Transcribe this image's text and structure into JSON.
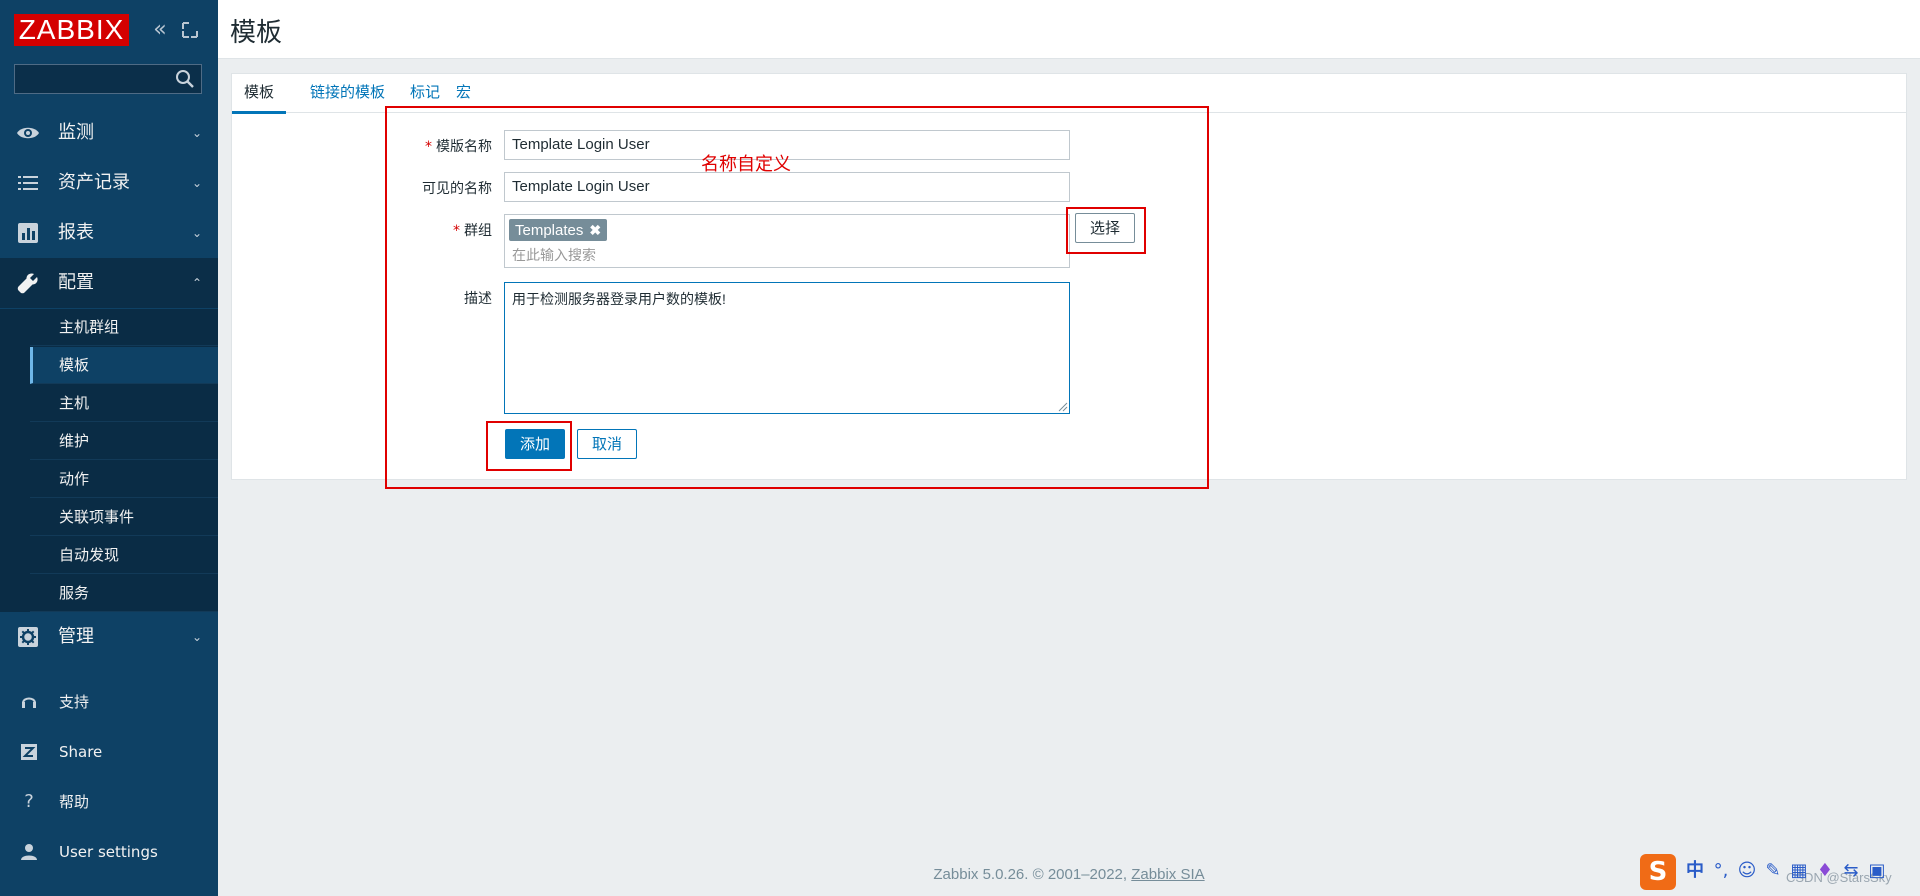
{
  "app": {
    "logo_text": "ZABBIX"
  },
  "sidebar": {
    "search": {
      "value": "",
      "placeholder": ""
    },
    "menu": [
      {
        "label": "监测",
        "icon": "eye-icon",
        "expanded": false
      },
      {
        "label": "资产记录",
        "icon": "list-icon",
        "expanded": false
      },
      {
        "label": "报表",
        "icon": "bar-chart-icon",
        "expanded": false
      },
      {
        "label": "配置",
        "icon": "wrench-icon",
        "expanded": true
      },
      {
        "label": "管理",
        "icon": "gear-icon",
        "expanded": false
      }
    ],
    "config_submenu": [
      {
        "label": "主机群组",
        "active": false
      },
      {
        "label": "模板",
        "active": true
      },
      {
        "label": "主机",
        "active": false
      },
      {
        "label": "维护",
        "active": false
      },
      {
        "label": "动作",
        "active": false
      },
      {
        "label": "关联项事件",
        "active": false
      },
      {
        "label": "自动发现",
        "active": false
      },
      {
        "label": "服务",
        "active": false
      }
    ],
    "aux": [
      {
        "label": "支持",
        "icon": "headset-icon"
      },
      {
        "label": "Share",
        "icon": "share-z-icon"
      },
      {
        "label": "帮助",
        "icon": "question-icon"
      },
      {
        "label": "User settings",
        "icon": "user-icon"
      }
    ]
  },
  "header": {
    "title": "模板"
  },
  "tabs": [
    {
      "label": "模板",
      "active": true
    },
    {
      "label": "链接的模板",
      "active": false
    },
    {
      "label": "标记",
      "active": false
    },
    {
      "label": "宏",
      "active": false
    }
  ],
  "form": {
    "required_mark": "*",
    "template_name": {
      "label": "模版名称",
      "value": "Template Login User"
    },
    "visible_name": {
      "label": "可见的名称",
      "value": "Template Login User"
    },
    "groups": {
      "label": "群组",
      "tag": "Templates",
      "placeholder": "在此输入搜索",
      "select_label": "选择"
    },
    "description": {
      "label": "描述",
      "value": "用于检测服务器登录用户数的模板!"
    },
    "add_label": "添加",
    "cancel_label": "取消"
  },
  "annotation": {
    "text": "名称自定义",
    "color": "#e00000"
  },
  "footer": {
    "text": "Zabbix 5.0.26. © 2001–2022, ",
    "link": "Zabbix SIA"
  },
  "ime": {
    "logo": "S",
    "items": [
      "中",
      "°,",
      "☺",
      "✎",
      "▦",
      "♦",
      "⇆",
      "▣"
    ]
  },
  "watermark": "CSDN @StarsSky",
  "colors": {
    "sidebar": "#0e4165",
    "accent": "#0275b8",
    "logo": "#d40000",
    "annotation": "#e00000"
  }
}
